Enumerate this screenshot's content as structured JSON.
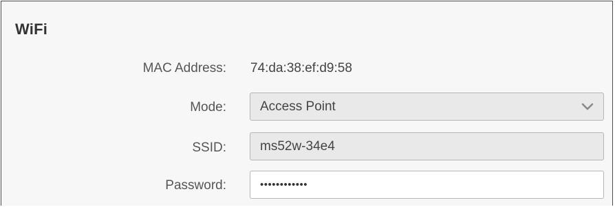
{
  "section": {
    "title": "WiFi"
  },
  "fields": {
    "mac": {
      "label": "MAC Address:",
      "value": "74:da:38:ef:d9:58"
    },
    "mode": {
      "label": "Mode:",
      "value": "Access Point",
      "icon": "chevron-down-icon"
    },
    "ssid": {
      "label": "SSID:",
      "value": "ms52w-34e4"
    },
    "password": {
      "label": "Password:",
      "value": "••••••••••••"
    }
  },
  "colors": {
    "panel_bg": "#f7f7f7",
    "field_bg_disabled": "#e9e9e9",
    "field_bg_input": "#ffffff",
    "border": "#b5b5b5",
    "label_text": "#555555"
  }
}
